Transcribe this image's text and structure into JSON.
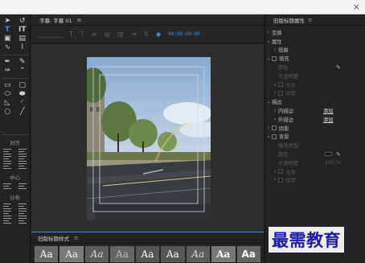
{
  "editor": {
    "tab_label": "字幕: 字幕 01",
    "menu_glyph": "≡",
    "timecode": "00:00:00:00"
  },
  "styles_panel": {
    "title": "旧版标题样式",
    "menu_glyph": "≡",
    "swatches": [
      "Aa",
      "Aa",
      "Aa",
      "Aa",
      "Aa",
      "Aa",
      "Aa",
      "Aa",
      "Aa"
    ]
  },
  "tools": {
    "align_title": "对齐",
    "center_title": "中心",
    "distribute_title": "分布"
  },
  "properties": {
    "title": "旧版标题属性",
    "menu_glyph": "≡",
    "rows": {
      "transform": "变换",
      "properties": "属性",
      "distort": "扭曲",
      "fill": "填充",
      "fill_type": "颜色",
      "fill_opacity": "不透明度",
      "sheen": "光泽",
      "texture": "纹理",
      "strokes": "描边",
      "inner_stroke": "内描边",
      "inner_add": "添加",
      "outer_stroke": "外描边",
      "outer_add": "添加",
      "shadow": "阴影",
      "background": "背景",
      "bg_fill_type": "填充类型",
      "bg_color": "颜色",
      "bg_opacity": "不透明度",
      "bg_opacity_val": "100 %",
      "bg_sheen": "光泽",
      "bg_texture": "纹理"
    }
  },
  "watermark": "最需教育"
}
